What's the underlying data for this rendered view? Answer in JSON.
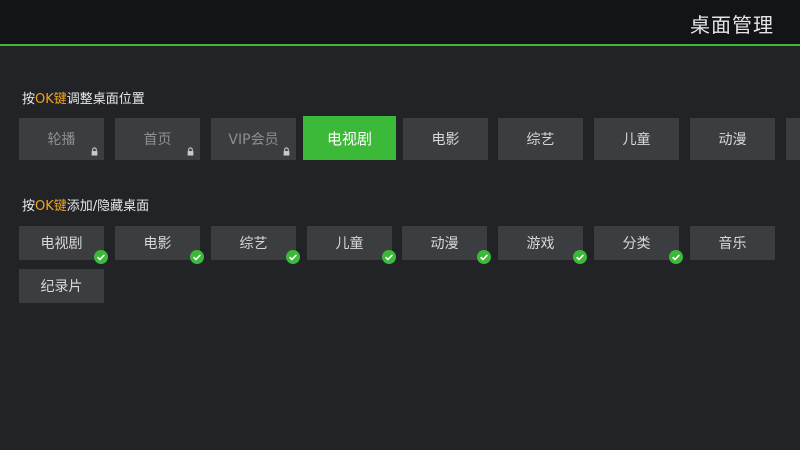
{
  "header": {
    "title": "桌面管理"
  },
  "reorder_section": {
    "prefix": "按",
    "key": "OK键",
    "suffix": "调整桌面位置",
    "tiles": [
      {
        "label": "轮播",
        "locked": true
      },
      {
        "label": "首页",
        "locked": true
      },
      {
        "label": "VIP会员",
        "locked": true
      },
      {
        "label": "电视剧",
        "focused": true
      },
      {
        "label": "电影"
      },
      {
        "label": "综艺"
      },
      {
        "label": "儿童"
      },
      {
        "label": "动漫"
      }
    ]
  },
  "toggle_section": {
    "prefix": "按",
    "key": "OK键",
    "suffix": "添加/隐藏桌面",
    "tiles": [
      {
        "label": "电视剧",
        "checked": true
      },
      {
        "label": "电影",
        "checked": true
      },
      {
        "label": "综艺",
        "checked": true
      },
      {
        "label": "儿童",
        "checked": true
      },
      {
        "label": "动漫",
        "checked": true
      },
      {
        "label": "游戏",
        "checked": true
      },
      {
        "label": "分类",
        "checked": true
      },
      {
        "label": "音乐",
        "checked": false
      },
      {
        "label": "纪录片",
        "checked": false
      }
    ]
  },
  "colors": {
    "accent": "#3db93a",
    "key_highlight": "#f0a51e",
    "background": "#222327"
  }
}
